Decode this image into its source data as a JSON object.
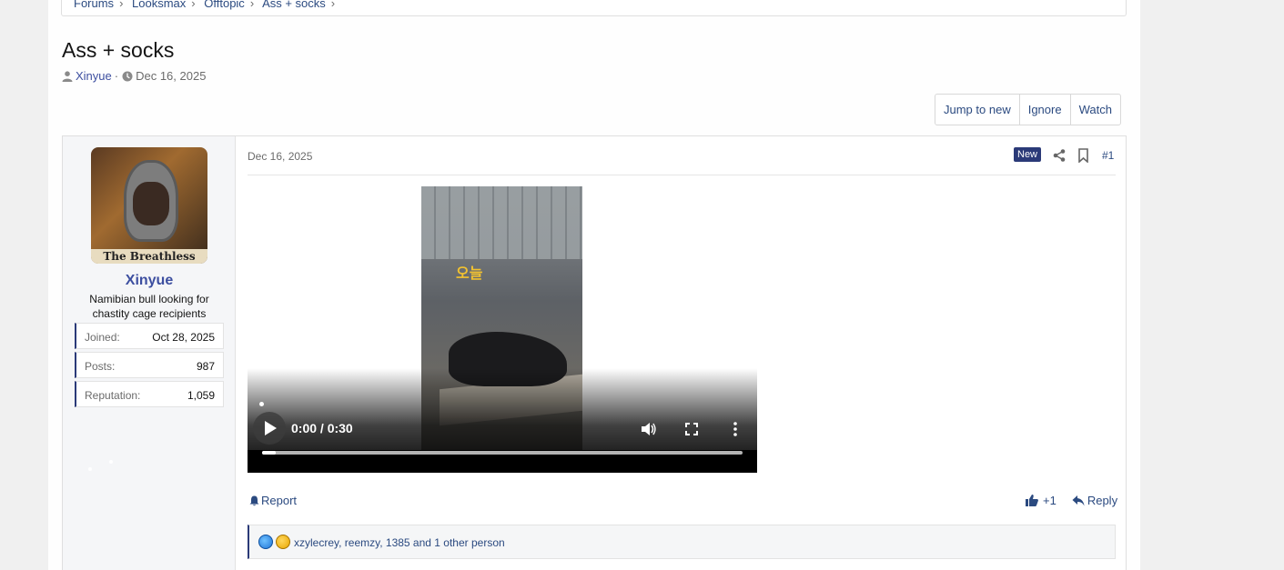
{
  "breadcrumb": [
    "Forums",
    "Looksmax",
    "Offtopic",
    "Ass + socks"
  ],
  "thread": {
    "title": "Ass + socks",
    "author": "Xinyue",
    "separator": "·",
    "date": "Dec 16, 2025"
  },
  "thread_buttons": {
    "jump": "Jump to new",
    "ignore": "Ignore",
    "watch": "Watch"
  },
  "user": {
    "name": "Xinyue",
    "title": "Namibian bull looking for chastity cage recipients",
    "avatar_caption": "The Breathless",
    "stats": [
      {
        "label": "Joined:",
        "value": "Oct 28, 2025"
      },
      {
        "label": "Posts:",
        "value": "987"
      },
      {
        "label": "Reputation:",
        "value": "1,059"
      }
    ]
  },
  "post": {
    "date": "Dec 16, 2025",
    "badge": "New",
    "number": "#1",
    "video": {
      "overlay_text": "오늘",
      "time": "0:00 / 0:30",
      "progress": 0.0
    },
    "report": "Report",
    "like": "+1",
    "reply": "Reply",
    "reactions": "xzylecrey, reemzy, 1385 and 1 other person"
  },
  "colors": {
    "accent": "#2b3a78",
    "link": "#2b4a80",
    "username": "#3d4fa0"
  }
}
